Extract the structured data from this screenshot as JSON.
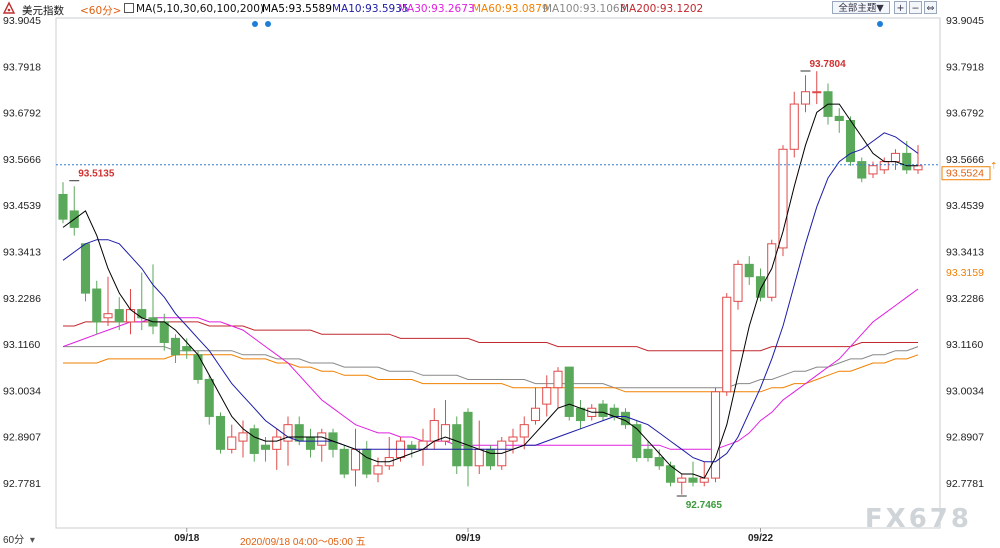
{
  "header": {
    "symbol": "美元指数",
    "period": "<60分>",
    "ma_label": "MA(5,10,30,60,100,200)",
    "ma5": "MA5:93.5589",
    "ma10": "MA10:93.5935",
    "ma30": "MA30:93.2673",
    "ma60": "MA60:93.0879",
    "ma100": "MA100:93.1063",
    "ma200": "MA200:93.1202",
    "theme_button": "全部主题▼"
  },
  "footer": {
    "period_select": "60分",
    "crosshair_time": "2020/09/18 04:00～05:00 五",
    "watermark": "FX678"
  },
  "colors": {
    "up": "#e04a4a",
    "down": "#5aa85a",
    "ma5": "#000000",
    "ma10": "#1c1ca6",
    "ma30": "#e020e0",
    "ma60": "#f08000",
    "ma100": "#888888",
    "ma200": "#c0282e",
    "current_price_line": "#2f7fd6"
  },
  "chart_data": {
    "type": "candlestick",
    "ylim": [
      92.7,
      93.95
    ],
    "y_ticks": [
      "93.9045",
      "93.7918",
      "93.6792",
      "93.5666",
      "93.4539",
      "93.3413",
      "93.2286",
      "93.1160",
      "93.0034",
      "92.8907",
      "92.7781"
    ],
    "x_labels": [
      {
        "index": 11,
        "label": "09/18"
      },
      {
        "index": 36,
        "label": "09/19"
      },
      {
        "index": 62,
        "label": "09/22"
      }
    ],
    "candles": [
      [
        93.48,
        93.42,
        93.51,
        93.41
      ],
      [
        93.44,
        93.4,
        93.5,
        93.38
      ],
      [
        93.36,
        93.24,
        93.36,
        93.22
      ],
      [
        93.25,
        93.17,
        93.27,
        93.14
      ],
      [
        93.18,
        93.19,
        93.28,
        93.16
      ],
      [
        93.2,
        93.17,
        93.23,
        93.15
      ],
      [
        93.17,
        93.2,
        93.25,
        93.14
      ],
      [
        93.2,
        93.18,
        93.29,
        93.15
      ],
      [
        93.18,
        93.16,
        93.31,
        93.14
      ],
      [
        93.17,
        93.12,
        93.19,
        93.1
      ],
      [
        93.13,
        93.09,
        93.14,
        93.07
      ],
      [
        93.11,
        93.1,
        93.13,
        93.08
      ],
      [
        93.09,
        93.03,
        93.1,
        93.02
      ],
      [
        93.03,
        92.94,
        93.04,
        92.92
      ],
      [
        92.94,
        92.86,
        92.95,
        92.85
      ],
      [
        92.86,
        92.89,
        92.92,
        92.85
      ],
      [
        92.88,
        92.9,
        92.93,
        92.84
      ],
      [
        92.91,
        92.85,
        92.92,
        92.83
      ],
      [
        92.87,
        92.86,
        92.89,
        92.83
      ],
      [
        92.86,
        92.89,
        92.91,
        92.81
      ],
      [
        92.88,
        92.92,
        92.94,
        92.82
      ],
      [
        92.92,
        92.88,
        92.94,
        92.87
      ],
      [
        92.89,
        92.86,
        92.91,
        92.84
      ],
      [
        92.87,
        92.9,
        92.91,
        92.83
      ],
      [
        92.9,
        92.86,
        92.91,
        92.84
      ],
      [
        92.86,
        92.8,
        92.87,
        92.79
      ],
      [
        92.81,
        92.86,
        92.91,
        92.77
      ],
      [
        92.86,
        92.8,
        92.88,
        92.79
      ],
      [
        92.8,
        92.82,
        92.84,
        92.78
      ],
      [
        92.82,
        92.84,
        92.89,
        92.81
      ],
      [
        92.84,
        92.88,
        92.89,
        92.83
      ],
      [
        92.87,
        92.86,
        92.88,
        92.84
      ],
      [
        92.86,
        92.88,
        92.91,
        92.82
      ],
      [
        92.88,
        92.93,
        92.96,
        92.86
      ],
      [
        92.88,
        92.92,
        92.98,
        92.87
      ],
      [
        92.92,
        92.82,
        92.94,
        92.8
      ],
      [
        92.95,
        92.82,
        92.96,
        92.77
      ],
      [
        92.82,
        92.86,
        92.93,
        92.8
      ],
      [
        92.86,
        92.82,
        92.87,
        92.81
      ],
      [
        92.82,
        92.88,
        92.89,
        92.81
      ],
      [
        92.88,
        92.89,
        92.91,
        92.85
      ],
      [
        92.89,
        92.92,
        92.94,
        92.86
      ],
      [
        92.93,
        92.96,
        93.01,
        92.92
      ],
      [
        92.97,
        93.01,
        93.04,
        92.94
      ],
      [
        93.01,
        93.05,
        93.06,
        92.96
      ],
      [
        93.06,
        92.94,
        93.06,
        92.93
      ],
      [
        92.96,
        92.93,
        92.98,
        92.91
      ],
      [
        92.94,
        92.96,
        92.97,
        92.93
      ],
      [
        92.97,
        92.94,
        92.98,
        92.93
      ],
      [
        92.96,
        92.94,
        92.97,
        92.93
      ],
      [
        92.95,
        92.92,
        92.96,
        92.91
      ],
      [
        92.92,
        92.84,
        92.93,
        92.83
      ],
      [
        92.86,
        92.84,
        92.88,
        92.83
      ],
      [
        92.84,
        92.82,
        92.86,
        92.81
      ],
      [
        92.82,
        92.78,
        92.83,
        92.77
      ],
      [
        92.78,
        92.79,
        92.8,
        92.75
      ],
      [
        92.79,
        92.78,
        92.83,
        92.77
      ],
      [
        92.78,
        92.79,
        92.83,
        92.77
      ],
      [
        92.79,
        93.0,
        93.01,
        92.78
      ],
      [
        93.0,
        93.23,
        93.24,
        92.99
      ],
      [
        93.22,
        93.31,
        93.32,
        93.2
      ],
      [
        93.31,
        93.28,
        93.33,
        93.26
      ],
      [
        93.28,
        93.23,
        93.3,
        93.22
      ],
      [
        93.23,
        93.36,
        93.37,
        93.22
      ],
      [
        93.35,
        93.59,
        93.6,
        93.33
      ],
      [
        93.59,
        93.7,
        93.73,
        93.57
      ],
      [
        93.7,
        93.73,
        93.77,
        93.68
      ],
      [
        93.73,
        93.73,
        93.78,
        93.7
      ],
      [
        93.73,
        93.67,
        93.75,
        93.65
      ],
      [
        93.67,
        93.66,
        93.69,
        93.63
      ],
      [
        93.66,
        93.56,
        93.67,
        93.55
      ],
      [
        93.56,
        93.52,
        93.57,
        93.51
      ],
      [
        93.53,
        93.55,
        93.56,
        93.52
      ],
      [
        93.54,
        93.56,
        93.57,
        93.53
      ],
      [
        93.56,
        93.58,
        93.59,
        93.54
      ],
      [
        93.58,
        93.54,
        93.61,
        93.53
      ],
      [
        93.54,
        93.55,
        93.6,
        93.53
      ]
    ],
    "ma5": [
      93.4,
      93.42,
      93.44,
      93.38,
      93.3,
      93.24,
      93.2,
      93.18,
      93.17,
      93.17,
      93.15,
      93.12,
      93.09,
      93.04,
      92.99,
      92.94,
      92.91,
      92.89,
      92.88,
      92.88,
      92.89,
      92.89,
      92.89,
      92.89,
      92.88,
      92.87,
      92.86,
      92.84,
      92.83,
      92.83,
      92.84,
      92.85,
      92.86,
      92.88,
      92.89,
      92.88,
      92.87,
      92.86,
      92.85,
      92.85,
      92.86,
      92.87,
      92.9,
      92.93,
      92.96,
      92.97,
      92.96,
      92.95,
      92.95,
      92.94,
      92.93,
      92.91,
      92.88,
      92.85,
      92.82,
      92.8,
      92.8,
      92.79,
      92.84,
      92.92,
      93.04,
      93.16,
      93.25,
      93.3,
      93.39,
      93.5,
      93.6,
      93.68,
      93.7,
      93.7,
      93.66,
      93.62,
      93.58,
      93.56,
      93.56,
      93.55,
      93.55
    ],
    "ma10": [
      93.32,
      93.34,
      93.36,
      93.37,
      93.37,
      93.36,
      93.33,
      93.3,
      93.26,
      93.23,
      93.19,
      93.16,
      93.13,
      93.1,
      93.06,
      93.02,
      92.99,
      92.96,
      92.93,
      92.91,
      92.89,
      92.88,
      92.88,
      92.88,
      92.88,
      92.87,
      92.86,
      92.86,
      92.86,
      92.86,
      92.86,
      92.86,
      92.86,
      92.86,
      92.86,
      92.86,
      92.86,
      92.86,
      92.86,
      92.86,
      92.86,
      92.87,
      92.87,
      92.88,
      92.89,
      92.9,
      92.91,
      92.92,
      92.93,
      92.94,
      92.94,
      92.93,
      92.92,
      92.9,
      92.88,
      92.86,
      92.84,
      92.83,
      92.83,
      92.85,
      92.89,
      92.95,
      93.01,
      93.08,
      93.16,
      93.26,
      93.36,
      93.45,
      93.52,
      93.56,
      93.58,
      93.59,
      93.61,
      93.63,
      93.62,
      93.6,
      93.58
    ],
    "ma30": [
      93.11,
      93.12,
      93.13,
      93.14,
      93.15,
      93.16,
      93.17,
      93.17,
      93.18,
      93.18,
      93.18,
      93.18,
      93.18,
      93.17,
      93.17,
      93.16,
      93.15,
      93.13,
      93.11,
      93.09,
      93.07,
      93.04,
      93.01,
      92.98,
      92.96,
      92.94,
      92.92,
      92.91,
      92.9,
      92.9,
      92.89,
      92.89,
      92.88,
      92.88,
      92.88,
      92.87,
      92.87,
      92.87,
      92.87,
      92.87,
      92.87,
      92.87,
      92.87,
      92.87,
      92.87,
      92.87,
      92.87,
      92.87,
      92.87,
      92.87,
      92.87,
      92.87,
      92.87,
      92.87,
      92.86,
      92.86,
      92.86,
      92.86,
      92.86,
      92.87,
      92.88,
      92.9,
      92.93,
      92.95,
      92.98,
      93.0,
      93.02,
      93.04,
      93.06,
      93.08,
      93.11,
      93.14,
      93.17,
      93.19,
      93.21,
      93.23,
      93.25
    ],
    "ma60": [
      93.07,
      93.07,
      93.07,
      93.07,
      93.08,
      93.08,
      93.08,
      93.08,
      93.08,
      93.08,
      93.09,
      93.09,
      93.09,
      93.09,
      93.09,
      93.09,
      93.08,
      93.08,
      93.08,
      93.07,
      93.07,
      93.06,
      93.06,
      93.05,
      93.05,
      93.04,
      93.04,
      93.04,
      93.03,
      93.03,
      93.03,
      93.03,
      93.02,
      93.02,
      93.02,
      93.02,
      93.02,
      93.02,
      93.02,
      93.02,
      93.01,
      93.01,
      93.01,
      93.01,
      93.01,
      93.01,
      93.01,
      93.01,
      93.01,
      93.01,
      93.0,
      93.0,
      93.0,
      93.0,
      93.0,
      93.0,
      93.0,
      93.0,
      93.0,
      93.0,
      93.0,
      93.0,
      93.0,
      93.01,
      93.01,
      93.02,
      93.02,
      93.03,
      93.04,
      93.05,
      93.05,
      93.06,
      93.07,
      93.07,
      93.08,
      93.08,
      93.09
    ],
    "ma100": [
      93.11,
      93.11,
      93.11,
      93.11,
      93.11,
      93.11,
      93.11,
      93.11,
      93.11,
      93.11,
      93.1,
      93.1,
      93.1,
      93.1,
      93.1,
      93.1,
      93.09,
      93.09,
      93.09,
      93.08,
      93.08,
      93.08,
      93.07,
      93.07,
      93.07,
      93.06,
      93.06,
      93.06,
      93.06,
      93.05,
      93.05,
      93.05,
      93.04,
      93.04,
      93.04,
      93.04,
      93.03,
      93.03,
      93.03,
      93.03,
      93.03,
      93.03,
      93.02,
      93.02,
      93.02,
      93.02,
      93.02,
      93.02,
      93.02,
      93.01,
      93.01,
      93.01,
      93.01,
      93.01,
      93.01,
      93.01,
      93.01,
      93.01,
      93.01,
      93.01,
      93.02,
      93.02,
      93.03,
      93.03,
      93.04,
      93.05,
      93.05,
      93.06,
      93.06,
      93.07,
      93.08,
      93.08,
      93.09,
      93.09,
      93.1,
      93.1,
      93.11
    ],
    "ma200": [
      93.16,
      93.16,
      93.17,
      93.17,
      93.17,
      93.17,
      93.17,
      93.17,
      93.17,
      93.17,
      93.17,
      93.17,
      93.17,
      93.16,
      93.16,
      93.16,
      93.16,
      93.15,
      93.15,
      93.15,
      93.15,
      93.15,
      93.15,
      93.14,
      93.14,
      93.14,
      93.14,
      93.14,
      93.14,
      93.14,
      93.13,
      93.13,
      93.13,
      93.13,
      93.13,
      93.13,
      93.13,
      93.12,
      93.12,
      93.12,
      93.12,
      93.12,
      93.12,
      93.12,
      93.11,
      93.11,
      93.11,
      93.11,
      93.11,
      93.11,
      93.11,
      93.11,
      93.1,
      93.1,
      93.1,
      93.1,
      93.1,
      93.1,
      93.1,
      93.1,
      93.1,
      93.1,
      93.1,
      93.11,
      93.11,
      93.11,
      93.11,
      93.11,
      93.11,
      93.11,
      93.11,
      93.12,
      93.12,
      93.12,
      93.12,
      93.12,
      93.12
    ],
    "current_price": 93.5524,
    "current_price_label": "93.5524",
    "ma30_axis_label": "93.3159",
    "annotations": [
      {
        "index": 1,
        "value": 93.5135,
        "text": "93.5135",
        "color": "#d03030"
      },
      {
        "index": 66,
        "value": 93.7804,
        "text": "93.7804",
        "color": "#d03030"
      },
      {
        "index": 55,
        "value": 92.7465,
        "text": "92.7465",
        "color": "#3a9a3a"
      }
    ]
  }
}
